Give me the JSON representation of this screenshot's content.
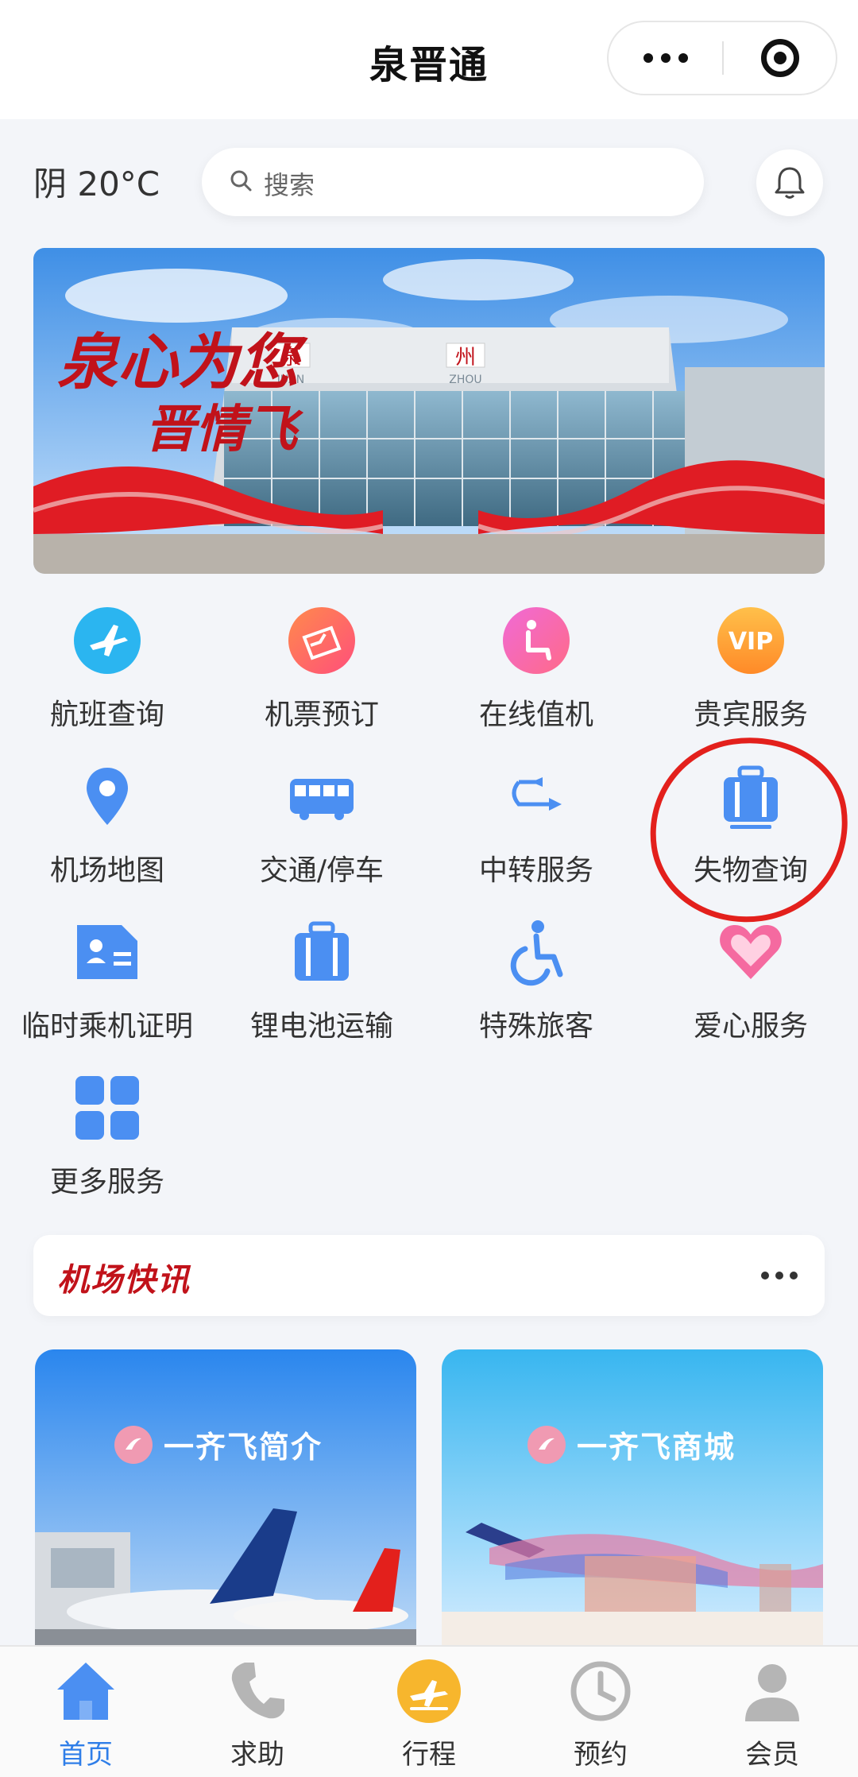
{
  "navbar": {
    "title": "泉晋通"
  },
  "header": {
    "weather": "阴 20°C",
    "search_placeholder": "搜索"
  },
  "banner": {
    "slogan_line1": "泉心为您",
    "slogan_line2": "晋情飞",
    "sign_cn_left": "泉",
    "sign_cn_right": "州",
    "sign_en_left": "JUAN",
    "sign_en_right": "ZHOU"
  },
  "services": [
    {
      "label": "航班查询",
      "icon": "plane-icon"
    },
    {
      "label": "机票预订",
      "icon": "ticket-icon"
    },
    {
      "label": "在线值机",
      "icon": "seat-icon"
    },
    {
      "label": "贵宾服务",
      "icon": "vip-icon",
      "icon_text": "VIP"
    },
    {
      "label": "机场地图",
      "icon": "map-pin-icon"
    },
    {
      "label": "交通/停车",
      "icon": "bus-icon"
    },
    {
      "label": "中转服务",
      "icon": "transfer-icon"
    },
    {
      "label": "失物查询",
      "icon": "luggage-icon"
    },
    {
      "label": "临时乘机证明",
      "icon": "id-card-icon"
    },
    {
      "label": "锂电池运输",
      "icon": "battery-case-icon"
    },
    {
      "label": "特殊旅客",
      "icon": "wheelchair-icon"
    },
    {
      "label": "爱心服务",
      "icon": "heart-icon"
    },
    {
      "label": "更多服务",
      "icon": "grid-icon"
    }
  ],
  "news": {
    "title": "机场快讯"
  },
  "promos": [
    {
      "label": "一齐飞简介"
    },
    {
      "label": "一齐飞商城"
    }
  ],
  "tabbar": [
    {
      "label": "首页",
      "icon": "home-icon",
      "active": true
    },
    {
      "label": "求助",
      "icon": "phone-icon",
      "active": false
    },
    {
      "label": "行程",
      "icon": "flight-icon",
      "active": false
    },
    {
      "label": "预约",
      "icon": "clock-icon",
      "active": false
    },
    {
      "label": "会员",
      "icon": "user-icon",
      "active": false
    }
  ],
  "colors": {
    "accent": "#2f7ee8",
    "icon_blue": "#4b8ff2",
    "annotation_red": "#e3201c",
    "news_red": "#c1121a"
  }
}
